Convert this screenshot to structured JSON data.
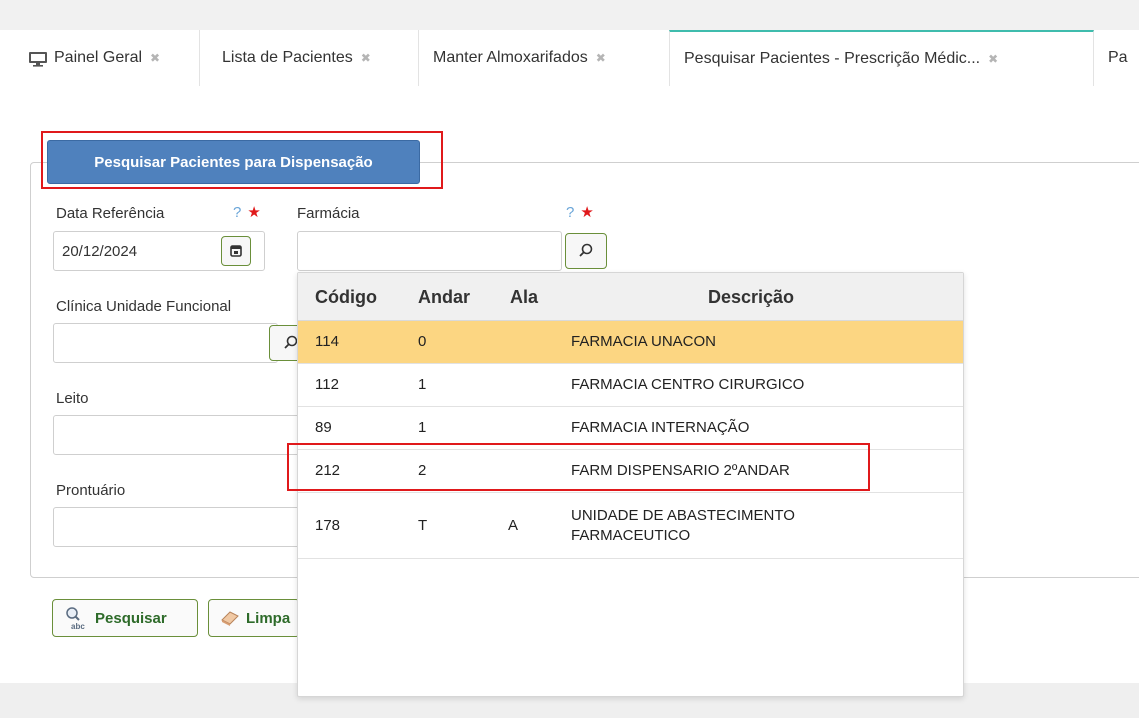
{
  "tabs": [
    {
      "label": "Painel Geral",
      "close": "✖"
    },
    {
      "label": "Lista de Pacientes",
      "close": "✖"
    },
    {
      "label": "Manter Almoxarifados",
      "close": "✖"
    },
    {
      "label": "Pesquisar Pacientes - Prescrição Médic...",
      "close": "✖"
    },
    {
      "label": "Pa"
    }
  ],
  "form": {
    "title": "Pesquisar Pacientes para Dispensação",
    "data_referencia_label": "Data Referência",
    "data_referencia_value": "20/12/2024",
    "farmacia_label": "Farmácia",
    "farmacia_value": "",
    "clinica_label": "Clínica Unidade Funcional",
    "leito_label": "Leito",
    "prontuario_label": "Prontuário",
    "help_mark": "?",
    "required_mark": "★"
  },
  "actions": {
    "pesquisar_label": "Pesquisar",
    "limpar_label": "Limpa"
  },
  "dropdown": {
    "columns": [
      "Código",
      "Andar",
      "Ala",
      "Descrição"
    ],
    "rows": [
      {
        "codigo": "114",
        "andar": "0",
        "ala": "",
        "descricao": "FARMACIA UNACON",
        "selected": true
      },
      {
        "codigo": "112",
        "andar": "1",
        "ala": "",
        "descricao": "FARMACIA CENTRO CIRURGICO"
      },
      {
        "codigo": "89",
        "andar": "1",
        "ala": "",
        "descricao": "FARMACIA INTERNAÇÃO"
      },
      {
        "codigo": "212",
        "andar": "2",
        "ala": "",
        "descricao": "FARM DISPENSARIO 2ºANDAR"
      },
      {
        "codigo": "178",
        "andar": "T",
        "ala": "A",
        "descricao": "UNIDADE DE ABASTECIMENTO FARMACEUTICO"
      }
    ]
  },
  "colors": {
    "accent_tab": "#3fbcad",
    "title_button": "#4f81bd",
    "selected_row": "#fcd682",
    "highlight_red": "#e0191b",
    "required_star": "#e0191b",
    "help_mark": "#6aa5d8"
  }
}
